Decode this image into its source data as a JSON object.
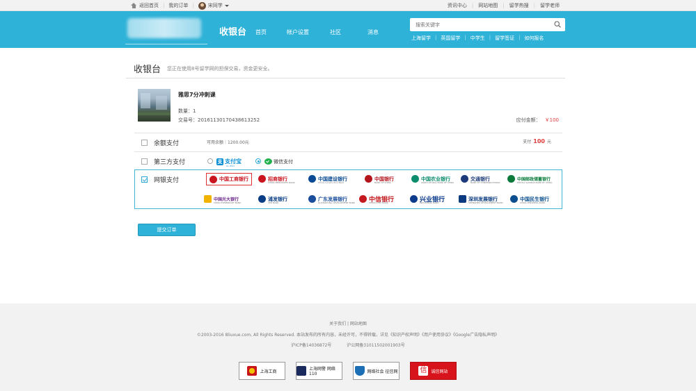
{
  "topbar": {
    "home": "返回首页",
    "orders": "我的订单",
    "user": "宋同学",
    "links": [
      "资讯中心",
      "网站地图",
      "留学热搜",
      "留学老师"
    ]
  },
  "header": {
    "title": "收银台",
    "nav": [
      "首页",
      "帐户设置",
      "社区",
      "消息"
    ],
    "search_placeholder": "搜索关键字",
    "hot": [
      "上海留学",
      "英国留学",
      "中学生",
      "留学签证",
      "如何报名"
    ]
  },
  "cashier": {
    "title": "收银台",
    "tip": "您正在使用8号留学网的担保交易，资金更安全。"
  },
  "order": {
    "name": "雅思7分冲刺课",
    "qty": "数量：1",
    "trade_no": "交易号：20161130170438613252",
    "due_label": "应付金额：",
    "due_value": "￥100"
  },
  "payment": {
    "balance": {
      "label": "余额支付",
      "available": "可用余额｜1200.00元",
      "pay_prefix": "支付",
      "pay_amount": "100",
      "pay_unit": "元"
    },
    "third": {
      "label": "第三方支付",
      "alipay": "支付宝",
      "alipay_en": "ALIPAY",
      "wechat": "微信支付"
    },
    "bank": {
      "label": "网银支付",
      "banks": [
        {
          "name": "中国工商银行",
          "en": "",
          "color": "#c9151e"
        },
        {
          "name": "招商银行",
          "en": "CHINA MERCHANTS BANK",
          "color": "#c9151e"
        },
        {
          "name": "中国建设银行",
          "en": "China Construction Bank",
          "color": "#0a4a94"
        },
        {
          "name": "中国银行",
          "en": "BANK OF CHINA",
          "color": "#b4151d"
        },
        {
          "name": "中国农业银行",
          "en": "AGRICULTURAL BANK OF CHINA",
          "color": "#0b8c6c"
        },
        {
          "name": "交通银行",
          "en": "BANK OF COMMUNICATIONS",
          "color": "#1d3b7a"
        },
        {
          "name": "中国邮政储蓄银行",
          "en": "POSTAL SAVINGS BANK OF CHINA",
          "color": "#0a7a3a"
        },
        {
          "name": "中国光大银行",
          "en": "CHINA EVERBRIGHT BANK",
          "color": "#6a2a8a"
        },
        {
          "name": "浦发银行",
          "en": "SPD BANK",
          "color": "#0a3d86"
        },
        {
          "name": "广东发展银行",
          "en": "GUANGDONG DEVELOPMENT BANK",
          "color": "#1a4d9c"
        },
        {
          "name": "中信银行",
          "en": "CHINA CITIC BANK",
          "color": "#c41a1f"
        },
        {
          "name": "兴业银行",
          "en": "INDUSTRIAL BANK",
          "color": "#0c3b8c"
        },
        {
          "name": "深圳发展银行",
          "en": "SHENZHEN DEVELOPMENT BANK",
          "color": "#0a3a80"
        },
        {
          "name": "中国民生银行",
          "en": "CHINA MINSHENG BANK",
          "color": "#0b4f8f"
        }
      ]
    }
  },
  "submit_label": "提交订单",
  "footer": {
    "links": "关于我们 | 网站地图",
    "copyright": "©2003-2016 8liuxue.com, All Rights Reserved.   本站发布的所有内容，未经许可，不得转载，详见《知识产权声明》《用户使用协议》《Google广告隐私声明》",
    "icp": "沪ICP备14036872号",
    "police": "沪公网备31011502001903号",
    "badges": [
      "上海工商",
      "上海网警 网络110",
      "网络社会 征信网",
      "诚信网站"
    ]
  },
  "colors": {
    "accent": "#2fb2d8",
    "price": "#e23c3c"
  }
}
